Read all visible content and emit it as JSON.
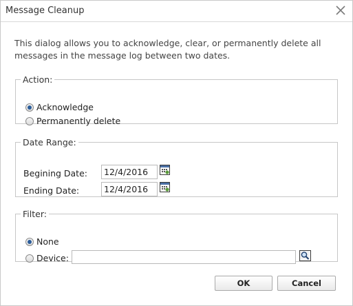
{
  "dialog": {
    "title": "Message Cleanup",
    "intro": "This dialog allows you to acknowledge, clear, or permanently delete all messages in the message log between two dates."
  },
  "action": {
    "legend": "Action:",
    "options": [
      {
        "label": "Acknowledge",
        "checked": true
      },
      {
        "label": "Permanently delete",
        "checked": false
      }
    ]
  },
  "date_range": {
    "legend": "Date Range:",
    "begin_label": "Begining Date:",
    "begin_value": "12/4/2016",
    "end_label": "Ending Date:",
    "end_value": "12/4/2016"
  },
  "filter": {
    "legend": "Filter:",
    "none_label": "None",
    "none_checked": true,
    "device_label": "Device:",
    "device_checked": false,
    "device_value": ""
  },
  "buttons": {
    "ok": "OK",
    "cancel": "Cancel"
  },
  "icons": {
    "close": "close-icon",
    "calendar": "calendar-icon",
    "search": "magnifier-icon"
  },
  "colors": {
    "radio_selected": "#2a5c9a",
    "border": "#c6c6c6"
  }
}
